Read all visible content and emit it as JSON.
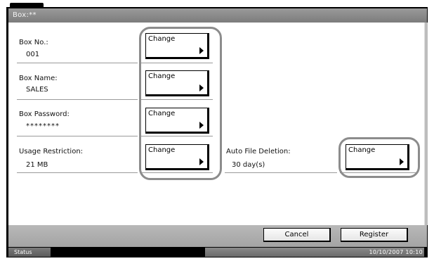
{
  "window": {
    "title": "Box:**"
  },
  "fields": {
    "box_no": {
      "label": "Box No.:",
      "value": "001",
      "button_label": "Change"
    },
    "box_name": {
      "label": "Box Name:",
      "value": "SALES",
      "button_label": "Change"
    },
    "box_password": {
      "label": "Box Password:",
      "value": "********",
      "button_label": "Change"
    },
    "usage_restriction": {
      "label": "Usage Restriction:",
      "value": "21 MB",
      "button_label": "Change"
    },
    "auto_file_deletion": {
      "label": "Auto File Deletion:",
      "value": "30 day(s)",
      "button_label": "Change"
    }
  },
  "footer": {
    "cancel_label": "Cancel",
    "register_label": "Register"
  },
  "status_bar": {
    "status_label": "Status",
    "datetime": "10/10/2007   10:10"
  },
  "icons": {
    "change_arrow": "right-triangle-icon"
  },
  "colors": {
    "titlebar": "#8a8a8a",
    "highlight_ring": "#8c8c8c",
    "status_bar": "#000000"
  }
}
